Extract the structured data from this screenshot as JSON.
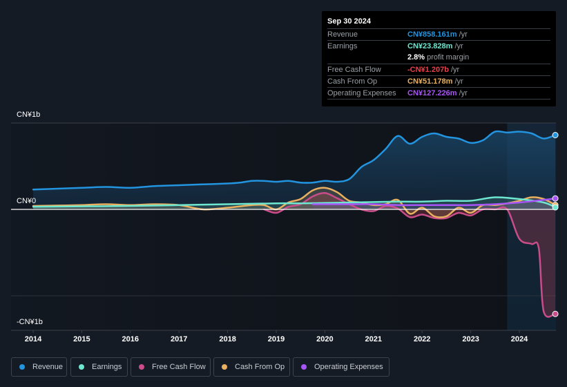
{
  "tooltip": {
    "date": "Sep 30 2024",
    "rows": [
      {
        "label": "Revenue",
        "value": "CN¥858.161m",
        "unit": "/yr",
        "color": "#2394df"
      },
      {
        "label": "Earnings",
        "value": "CN¥23.828m",
        "unit": "/yr",
        "color": "#6ee7d0"
      },
      {
        "label": "",
        "margin_value": "2.8%",
        "margin_label": "profit margin"
      },
      {
        "label": "Free Cash Flow",
        "value": "-CN¥1.207b",
        "unit": "/yr",
        "color": "#e8404a"
      },
      {
        "label": "Cash From Op",
        "value": "CN¥51.178m",
        "unit": "/yr",
        "color": "#e8b060"
      },
      {
        "label": "Operating Expenses",
        "value": "CN¥127.226m",
        "unit": "/yr",
        "color": "#a855f7"
      }
    ]
  },
  "legend": [
    {
      "label": "Revenue",
      "color": "#2394df"
    },
    {
      "label": "Earnings",
      "color": "#6ee7d0"
    },
    {
      "label": "Free Cash Flow",
      "color": "#c94d8a"
    },
    {
      "label": "Cash From Op",
      "color": "#e8b060"
    },
    {
      "label": "Operating Expenses",
      "color": "#a855f7"
    }
  ],
  "chart_data": {
    "type": "line",
    "title": "",
    "xlabel": "",
    "ylabel": "",
    "y_tick_labels": [
      "CN¥1b",
      "CN¥0",
      "-CN¥1b"
    ],
    "x_tick_labels": [
      "2014",
      "2015",
      "2016",
      "2017",
      "2018",
      "2019",
      "2020",
      "2021",
      "2022",
      "2023",
      "2024"
    ],
    "ylim": [
      -1.4,
      1.0
    ],
    "xlim": [
      2013.55,
      2024.75
    ],
    "units": "CN¥ billions",
    "highlight_region": [
      2023.75,
      2024.75
    ],
    "grid": true,
    "legend_position": "bottom",
    "series": [
      {
        "name": "Revenue",
        "color": "#2394df",
        "x": [
          2014.0,
          2014.5,
          2015.0,
          2015.5,
          2016.0,
          2016.5,
          2017.0,
          2017.5,
          2018.0,
          2018.25,
          2018.5,
          2018.75,
          2019.0,
          2019.25,
          2019.5,
          2019.75,
          2020.0,
          2020.25,
          2020.5,
          2020.75,
          2021.0,
          2021.25,
          2021.5,
          2021.75,
          2022.0,
          2022.25,
          2022.5,
          2022.75,
          2023.0,
          2023.25,
          2023.5,
          2023.75,
          2024.0,
          2024.25,
          2024.5,
          2024.74
        ],
        "values": [
          0.23,
          0.24,
          0.25,
          0.26,
          0.25,
          0.27,
          0.28,
          0.29,
          0.3,
          0.31,
          0.33,
          0.33,
          0.32,
          0.33,
          0.31,
          0.31,
          0.33,
          0.32,
          0.35,
          0.49,
          0.57,
          0.7,
          0.85,
          0.76,
          0.84,
          0.88,
          0.84,
          0.82,
          0.77,
          0.8,
          0.9,
          0.89,
          0.9,
          0.88,
          0.82,
          0.86
        ]
      },
      {
        "name": "Earnings",
        "color": "#6ee7d0",
        "x": [
          2014.0,
          2015.0,
          2016.0,
          2017.0,
          2018.0,
          2019.0,
          2019.5,
          2020.0,
          2020.5,
          2021.0,
          2021.5,
          2022.0,
          2022.5,
          2023.0,
          2023.5,
          2024.0,
          2024.5,
          2024.74
        ],
        "values": [
          0.03,
          0.035,
          0.04,
          0.05,
          0.06,
          0.07,
          0.07,
          0.075,
          0.08,
          0.085,
          0.09,
          0.09,
          0.1,
          0.1,
          0.14,
          0.12,
          0.08,
          0.024
        ]
      },
      {
        "name": "Free Cash Flow",
        "color": "#c94d8a",
        "x": [
          2018.75,
          2019.0,
          2019.25,
          2019.5,
          2019.75,
          2020.0,
          2020.25,
          2020.5,
          2020.75,
          2021.0,
          2021.25,
          2021.5,
          2021.75,
          2022.0,
          2022.25,
          2022.5,
          2022.75,
          2023.0,
          2023.25,
          2023.5,
          2023.75,
          2024.0,
          2024.25,
          2024.4,
          2024.5,
          2024.74
        ],
        "values": [
          0.0,
          -0.04,
          0.03,
          0.06,
          0.15,
          0.19,
          0.13,
          0.06,
          0.0,
          -0.02,
          0.04,
          0.01,
          -0.09,
          -0.06,
          -0.1,
          -0.1,
          -0.04,
          -0.07,
          0.0,
          0.0,
          0.0,
          -0.34,
          -0.4,
          -0.45,
          -1.18,
          -1.21
        ]
      },
      {
        "name": "Cash From Op",
        "color": "#e8b060",
        "x": [
          2014.0,
          2014.5,
          2015.0,
          2015.5,
          2016.0,
          2016.5,
          2017.0,
          2017.5,
          2018.0,
          2018.5,
          2018.75,
          2019.0,
          2019.25,
          2019.5,
          2019.75,
          2020.0,
          2020.25,
          2020.5,
          2020.75,
          2021.0,
          2021.25,
          2021.5,
          2021.75,
          2022.0,
          2022.25,
          2022.5,
          2022.75,
          2023.0,
          2023.25,
          2023.5,
          2023.75,
          2024.0,
          2024.25,
          2024.5,
          2024.74
        ],
        "values": [
          0.04,
          0.045,
          0.05,
          0.06,
          0.05,
          0.06,
          0.05,
          0.0,
          0.02,
          0.05,
          0.05,
          0.0,
          0.08,
          0.12,
          0.22,
          0.25,
          0.2,
          0.1,
          0.08,
          0.05,
          0.06,
          0.11,
          -0.05,
          0.02,
          -0.08,
          -0.08,
          0.02,
          -0.04,
          0.05,
          0.05,
          0.07,
          0.1,
          0.14,
          0.12,
          0.051
        ]
      },
      {
        "name": "Operating Expenses",
        "color": "#a855f7",
        "x": [
          2019.75,
          2020.0,
          2020.5,
          2021.0,
          2021.5,
          2022.0,
          2022.5,
          2023.0,
          2023.5,
          2024.0,
          2024.5,
          2024.74
        ],
        "values": [
          0.06,
          0.06,
          0.06,
          0.06,
          0.05,
          0.05,
          0.05,
          0.05,
          0.06,
          0.08,
          0.11,
          0.127
        ]
      }
    ]
  }
}
